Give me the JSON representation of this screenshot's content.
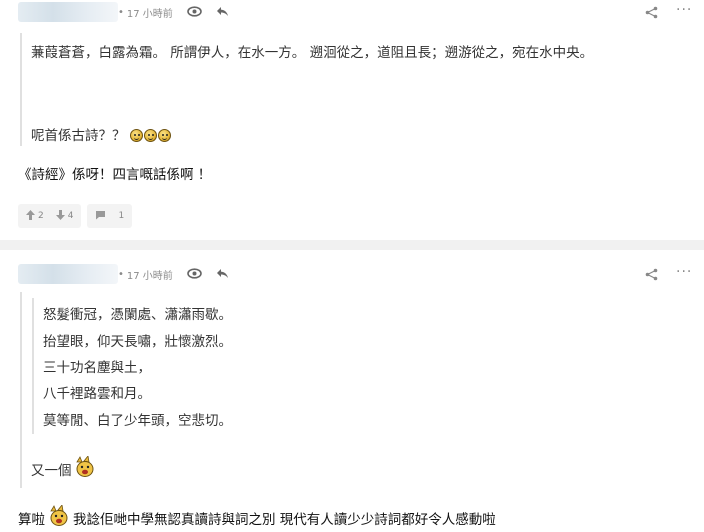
{
  "post1": {
    "time": "17 小時前",
    "quote_line1": "蒹葭蒼蒼，白露為霜。 所謂伊人，在水一方。 遡洄從之，道阻且長；遡游從之，宛在水中央。",
    "quote_line2": "呢首係古詩？？",
    "quote_emojis": [
      "laugh-emoji",
      "laugh-emoji",
      "laugh-emoji"
    ],
    "body": "《詩經》係呀！四言嘅話係啊 ！",
    "likes": "2",
    "dislikes": "4",
    "replies": "1"
  },
  "post2": {
    "time": "17 小時前",
    "poem": [
      "怒髮衝冠，憑闌處、瀟瀟雨歇。",
      "抬望眼，仰天長嘯，壯懷激烈。",
      "三十功名塵與土，",
      "八千裡路雲和月。",
      "莫等閒、白了少年頭，空悲切。"
    ],
    "quote_tail": "又一個",
    "body_prefix": "算啦",
    "body_text": "我諗佢哋中學無認真讀詩與詞之別 現代有人讀少少詩詞都好令人感動啦"
  },
  "colors": {
    "meta_gray": "#8a8a8a",
    "quote_bar": "#e0e0e0",
    "divider": "#f1f1f1"
  }
}
